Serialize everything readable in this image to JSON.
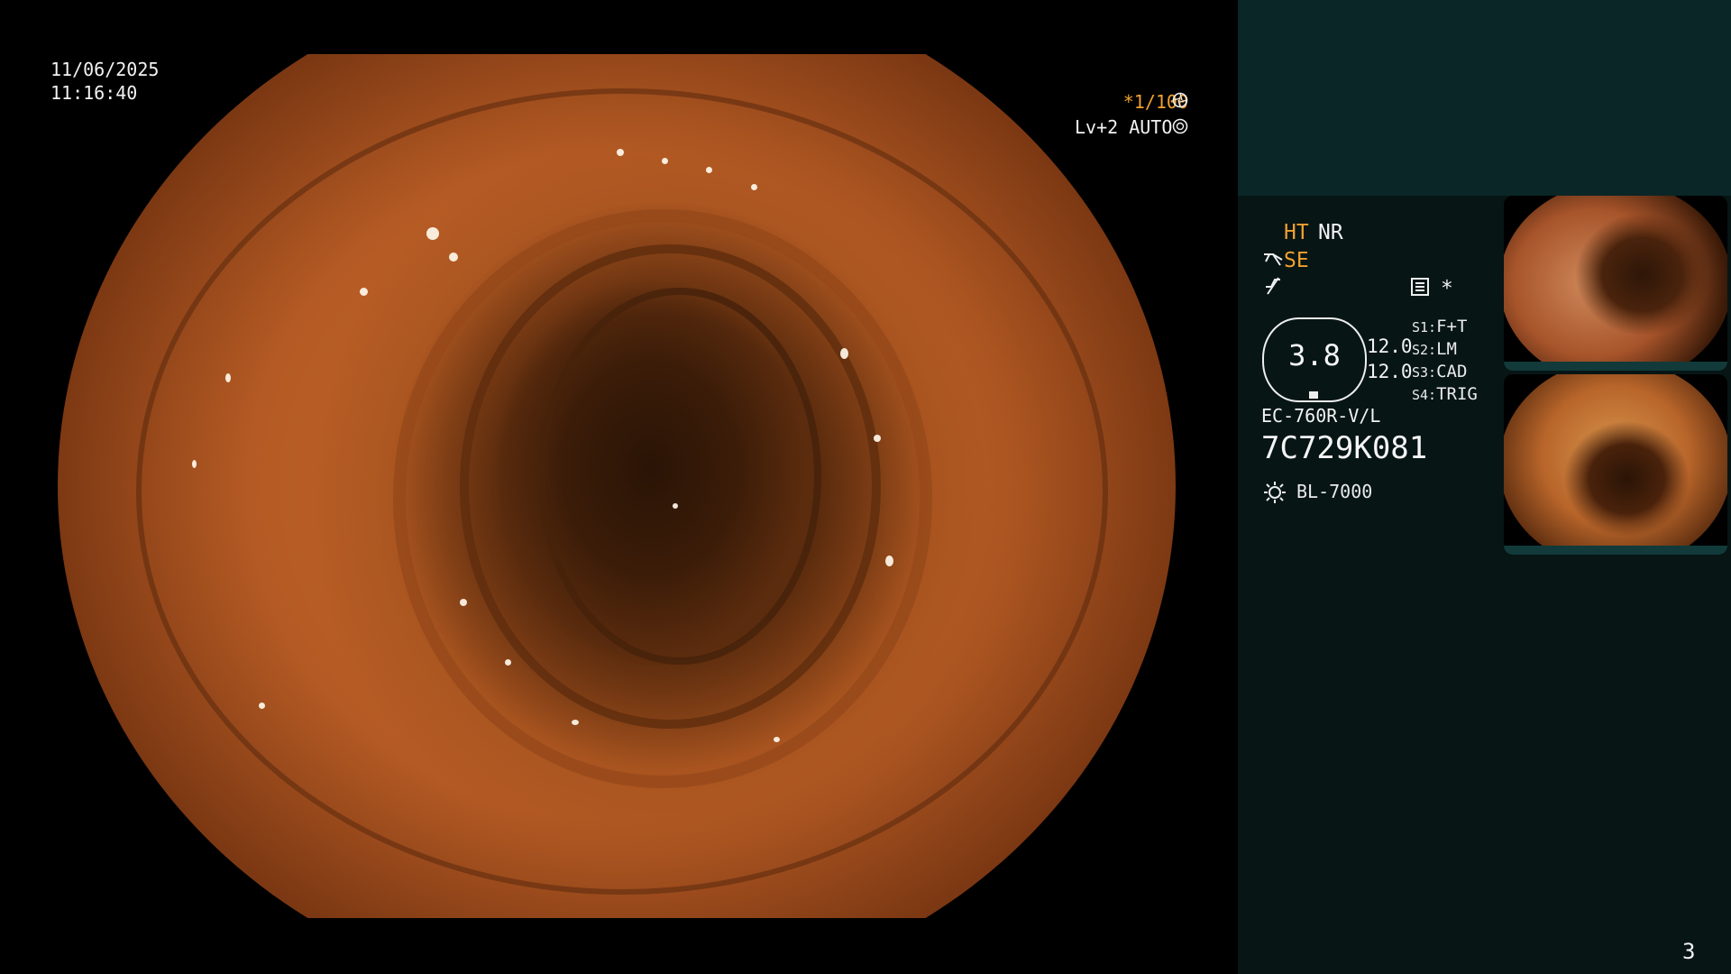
{
  "overlay": {
    "date": "11/06/2025",
    "time": "11:16:40",
    "shutter": "*1/100",
    "shutter_icon": "aperture-icon",
    "level": "Lv+2 AUTO",
    "level_icon": "iris-icon"
  },
  "panel": {
    "modes": {
      "ht": "HT",
      "nr": "NR",
      "se": "SE"
    },
    "icons": [
      "scope-tip-icon",
      "flash-off-icon",
      "memory-card-icon",
      "asterisk-icon",
      "light-source-icon"
    ],
    "asterisk": "*",
    "zoom_value": "3.8",
    "gauge_values": [
      "12.0",
      "12.0"
    ],
    "switches": [
      {
        "key": "S1:",
        "value": "F+T"
      },
      {
        "key": "S2:",
        "value": "LM"
      },
      {
        "key": "S3:",
        "value": "CAD"
      },
      {
        "key": "S4:",
        "value": "TRIG"
      }
    ],
    "scope_model": "EC-760R-V/L",
    "scope_serial": "7C729K081",
    "light_source": "BL-7000",
    "page_number": "3"
  },
  "colors": {
    "accent_orange": "#f0a030",
    "panel_dark": "#071515",
    "panel_teal": "#0b2627"
  }
}
